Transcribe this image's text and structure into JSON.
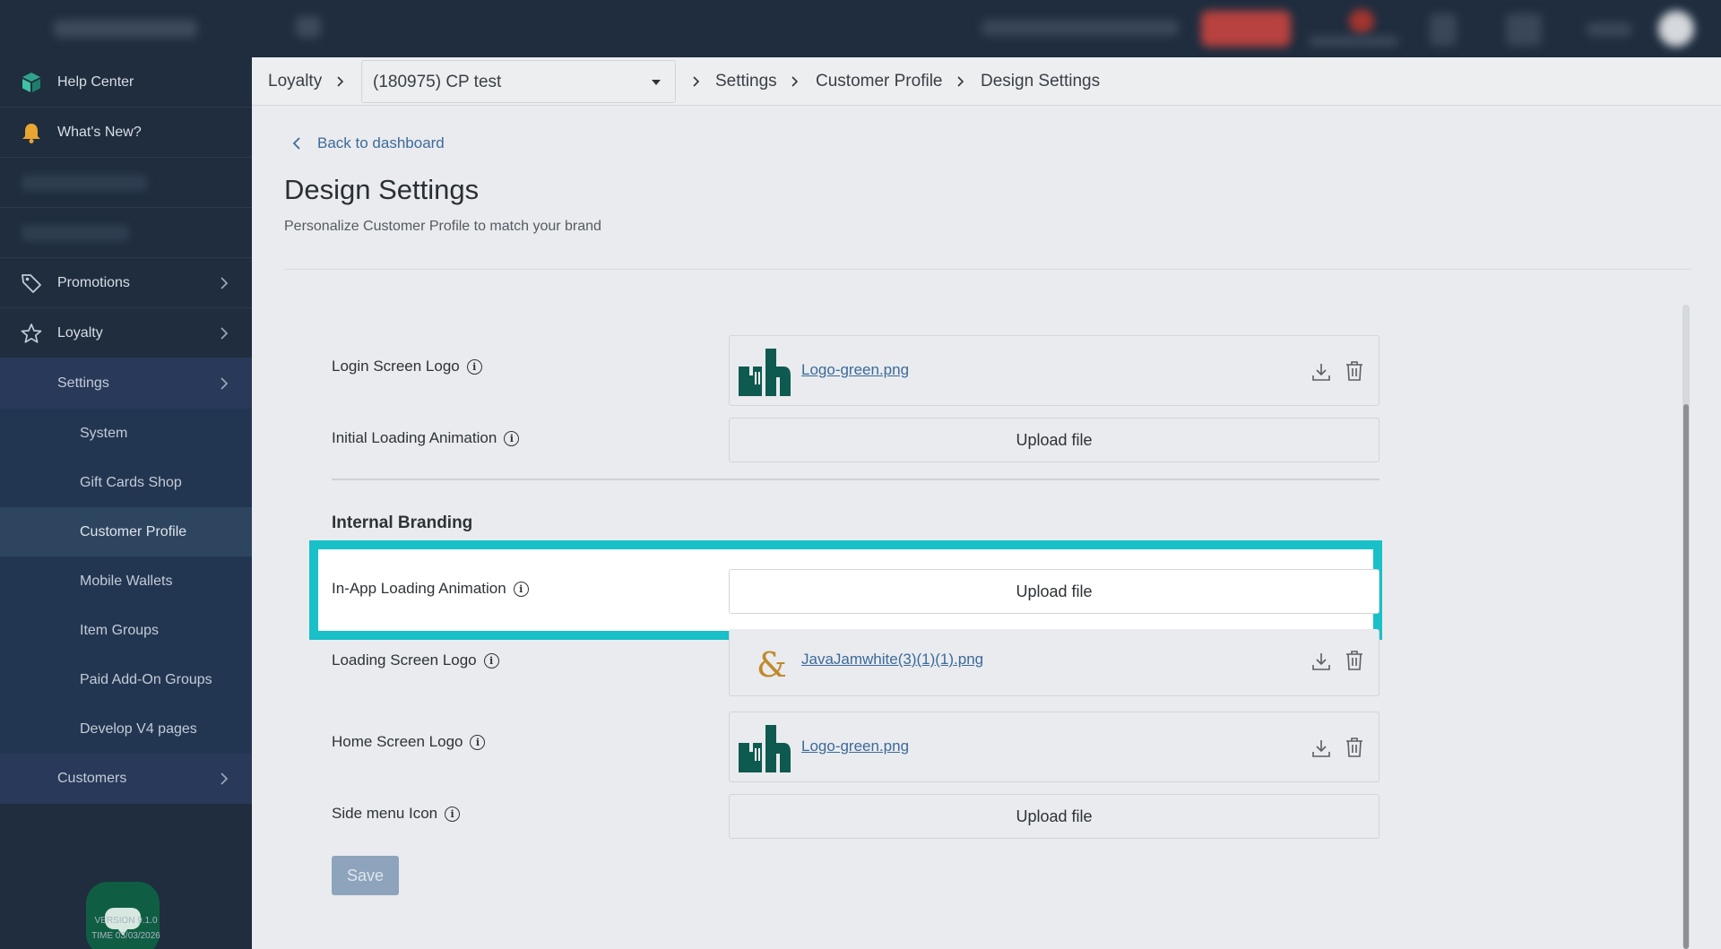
{
  "sidebar": {
    "items": [
      {
        "label": "Help Center"
      },
      {
        "label": "What's New?"
      },
      {
        "label": "Promotions"
      },
      {
        "label": "Loyalty"
      }
    ],
    "settings_label": "Settings",
    "sub_items": [
      {
        "label": "System"
      },
      {
        "label": "Gift Cards Shop"
      },
      {
        "label": "Customer Profile"
      },
      {
        "label": "Mobile Wallets"
      },
      {
        "label": "Item Groups"
      },
      {
        "label": "Paid Add-On Groups"
      },
      {
        "label": "Develop V4 pages"
      }
    ],
    "customers_label": "Customers",
    "version": "VERSION 9.1.0",
    "time": "TIME 03/03/2026"
  },
  "breadcrumb": {
    "root": "Loyalty",
    "location": "(180975) CP test",
    "settings": "Settings",
    "customer_profile": "Customer Profile",
    "current": "Design Settings"
  },
  "main": {
    "back_label": "Back to dashboard",
    "title": "Design Settings",
    "subtitle": "Personalize Customer Profile to match your brand",
    "section_internal": "Internal Branding",
    "save_label": "Save",
    "rows": {
      "login_logo": {
        "label": "Login Screen Logo",
        "file": "Logo-green.png"
      },
      "initial_anim": {
        "label": "Initial Loading Animation",
        "upload": "Upload file"
      },
      "inapp_anim": {
        "label": "In-App Loading Animation",
        "upload": "Upload file"
      },
      "loading_logo": {
        "label": "Loading Screen Logo",
        "file": "JavaJamwhite(3)(1)(1).png"
      },
      "home_logo": {
        "label": "Home Screen Logo",
        "file": "Logo-green.png"
      },
      "side_icon": {
        "label": "Side menu Icon",
        "upload": "Upload file"
      }
    }
  },
  "colors": {
    "highlight": "#19c0c8",
    "sidebar_bg": "#1f2d3f",
    "link": "#3b6a9a"
  }
}
